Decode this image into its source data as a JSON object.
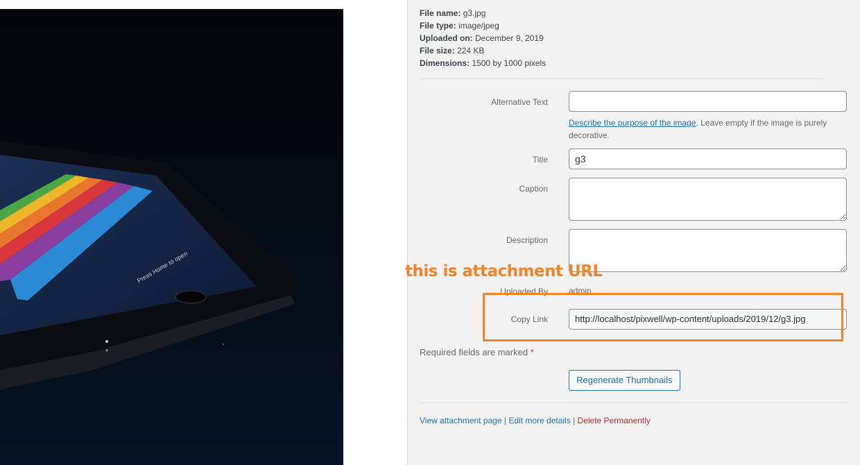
{
  "file_meta": {
    "file_name_label": "File name:",
    "file_name": "g3.jpg",
    "file_type_label": "File type:",
    "file_type": "image/jpeg",
    "uploaded_on_label": "Uploaded on:",
    "uploaded_on": "December 9, 2019",
    "file_size_label": "File size:",
    "file_size": "224 KB",
    "dimensions_label": "Dimensions:",
    "dimensions": "1500 by 1000 pixels"
  },
  "form": {
    "alt_text": {
      "label": "Alternative Text",
      "value": ""
    },
    "alt_help_link": "Describe the purpose of the image",
    "alt_help_text": ". Leave empty if the image is purely decorative.",
    "title": {
      "label": "Title",
      "value": "g3"
    },
    "caption": {
      "label": "Caption",
      "value": ""
    },
    "description": {
      "label": "Description",
      "value": ""
    },
    "uploaded_by": {
      "label": "Uploaded By",
      "value": "admin"
    },
    "copy_link": {
      "label": "Copy Link",
      "value": "http://localhost/pixwell/wp-content/uploads/2019/12/g3.jpg"
    }
  },
  "required_note": "Required fields are marked",
  "required_star": "*",
  "regenerate_button": "Regenerate Thumbnails",
  "actions": {
    "view": "View attachment page",
    "sep1": "|",
    "edit": "Edit more details",
    "sep2": "|",
    "delete": "Delete Permanently"
  },
  "annotation": {
    "text": "this is attachment URL",
    "color": "#f5832a"
  },
  "colors": {
    "link": "#2271b1",
    "danger": "#b32d2e",
    "panel_bg": "#f2f2f2"
  }
}
